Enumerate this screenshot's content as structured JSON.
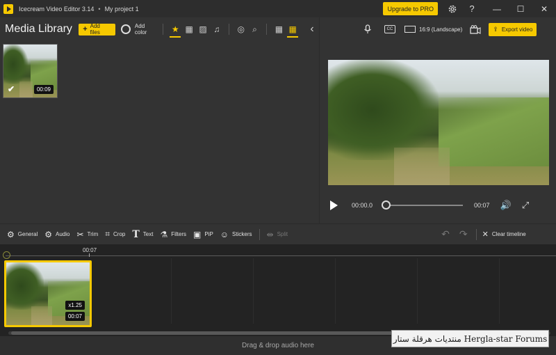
{
  "titlebar": {
    "app_name": "Icecream Video Editor 3.14",
    "separator": "•",
    "project_name": "My project 1",
    "upgrade_label": "Upgrade to PRO",
    "settings_icon": "gear-icon",
    "help_icon": "question-mark-icon",
    "help_glyph": "?",
    "minimize_glyph": "—",
    "maximize_glyph": "☐",
    "close_glyph": "✕"
  },
  "media_library": {
    "title": "Media Library",
    "add_files_label": "Add files",
    "add_files_plus": "+",
    "add_color_label": "Add color",
    "filters": [
      {
        "name": "all",
        "icon": "star-icon",
        "glyph": "★",
        "active": true
      },
      {
        "name": "video",
        "icon": "film-icon",
        "glyph": "▦",
        "active": false
      },
      {
        "name": "image",
        "icon": "image-icon",
        "glyph": "▨",
        "active": false
      },
      {
        "name": "audio",
        "icon": "music-icon",
        "glyph": "♫",
        "active": false
      }
    ],
    "view_icons": {
      "record": "◎",
      "search": "⌕",
      "grid_large": "▦",
      "grid_small": "▦",
      "collapse": "‹"
    },
    "items": [
      {
        "duration": "00:09",
        "selected": true,
        "check_glyph": "✔"
      }
    ]
  },
  "preview": {
    "mic_glyph": "🎙",
    "cc_label": "CC",
    "aspect_label": "16:9 (Landscape)",
    "camera_glyph": "⏺",
    "export_label": "Export video",
    "export_glyph": "⇪",
    "time_current": "00:00.0",
    "time_total": "00:07",
    "seek_position": 0,
    "volume_glyph": "🔊",
    "fullscreen_glyph": "⤢"
  },
  "edit_toolbar": {
    "tools": [
      {
        "label": "General",
        "icon": "gear-icon",
        "glyph": "⚙",
        "enabled": true
      },
      {
        "label": "Audio",
        "icon": "audio-gear-icon",
        "glyph": "⚙",
        "enabled": true
      },
      {
        "label": "Trim",
        "icon": "scissors-icon",
        "glyph": "✂",
        "enabled": true
      },
      {
        "label": "Crop",
        "icon": "crop-icon",
        "glyph": "⌗",
        "enabled": true
      },
      {
        "label": "Text",
        "icon": "text-icon",
        "glyph": "T",
        "enabled": true
      },
      {
        "label": "Filters",
        "icon": "filters-icon",
        "glyph": "⚗",
        "enabled": true
      },
      {
        "label": "PiP",
        "icon": "pip-icon",
        "glyph": "▣",
        "enabled": true
      },
      {
        "label": "Stickers",
        "icon": "sticker-icon",
        "glyph": "☺",
        "enabled": true
      },
      {
        "label": "Split",
        "icon": "split-icon",
        "glyph": "⇹",
        "enabled": false
      }
    ],
    "undo_glyph": "↶",
    "redo_glyph": "↷",
    "clear_label": "Clear timeline",
    "clear_glyph": "✕"
  },
  "timeline": {
    "ruler_label": "00:07",
    "clips": [
      {
        "speed": "x1.25",
        "duration": "00:07"
      }
    ],
    "audio_drop_label": "Drag & drop audio here"
  },
  "watermark": {
    "text": "منتديات هرقلة ستار Hergla-star Forums"
  },
  "colors": {
    "accent": "#f6c900",
    "panel": "#333333",
    "timeline_bg": "#232323"
  }
}
